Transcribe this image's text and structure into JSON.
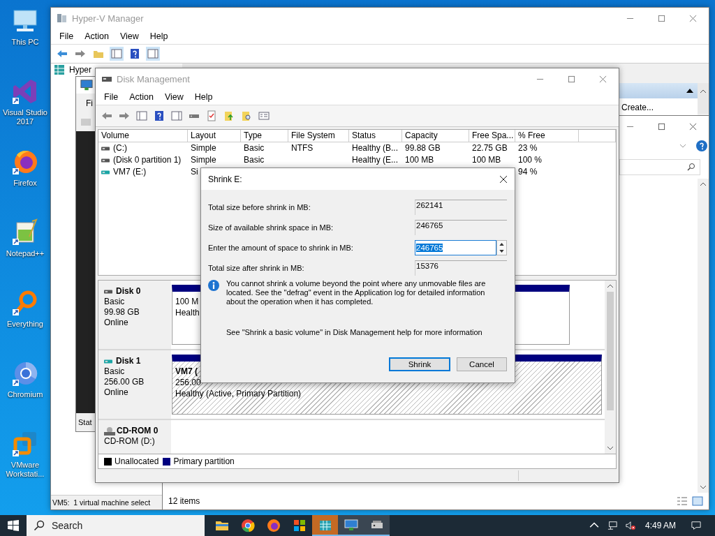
{
  "desktop_icons": [
    {
      "kind": "pc",
      "label": "This PC",
      "shortcut": false
    },
    {
      "kind": "vs",
      "label": "Visual Studio 2017",
      "shortcut": true
    },
    {
      "kind": "firefox",
      "label": "Firefox",
      "shortcut": true
    },
    {
      "kind": "notepad",
      "label": "Notepad++",
      "shortcut": true
    },
    {
      "kind": "everything",
      "label": "Everything",
      "shortcut": true
    },
    {
      "kind": "chromium",
      "label": "Chromium",
      "shortcut": true
    },
    {
      "kind": "vmware",
      "label": "VMware Workstati...",
      "shortcut": true
    }
  ],
  "hyperv": {
    "title": "Hyper-V Manager",
    "menu": [
      "File",
      "Action",
      "View",
      "Help"
    ],
    "tree_root": "Hyper",
    "actions_item": "Create...",
    "status": "VM5:  1 virtual machine select"
  },
  "vm_window": {
    "menu_item": "Fi",
    "status": "Stat"
  },
  "explorer": {
    "status": "12 items"
  },
  "disk_management": {
    "title": "Disk Management",
    "menu": [
      "File",
      "Action",
      "View",
      "Help"
    ],
    "columns": [
      "Volume",
      "Layout",
      "Type",
      "File System",
      "Status",
      "Capacity",
      "Free Spa...",
      "% Free"
    ],
    "rows": [
      {
        "kind": "hdd",
        "cells": [
          "(C:)",
          "Simple",
          "Basic",
          "NTFS",
          "Healthy (B...",
          "99.88 GB",
          "22.75 GB",
          "23 %"
        ]
      },
      {
        "kind": "hdd",
        "cells": [
          "(Disk 0 partition 1)",
          "Simple",
          "Basic",
          null,
          "Healthy (E...",
          "100 MB",
          "100 MB",
          "100 %"
        ]
      },
      {
        "kind": "vhd",
        "cells": [
          "VM7 (E:)",
          "Si",
          null,
          null,
          null,
          null,
          null,
          "94 %"
        ]
      }
    ],
    "disks": [
      {
        "kind": "hdd",
        "name": "Disk 0",
        "type": "Basic",
        "size": "99.98 GB",
        "status": "Online",
        "partitions": [
          {
            "lines": [
              "100 M",
              "Health"
            ],
            "selected": false
          },
          {
            "selected": false
          }
        ]
      },
      {
        "kind": "vhd",
        "name": "Disk 1",
        "type": "Basic",
        "size": "256.00 GB",
        "status": "Online",
        "partitions": [
          {
            "name": "VM7 (",
            "lines": [
              "256.00",
              "Healthy (Active, Primary Partition)"
            ],
            "selected": true
          }
        ]
      },
      {
        "kind": "cdrom",
        "name": "CD-ROM 0",
        "type": "CD-ROM (D:)"
      }
    ],
    "legend": [
      {
        "label": "Unallocated",
        "color": "#000000"
      },
      {
        "label": "Primary partition",
        "color": "#000080"
      }
    ]
  },
  "dialog": {
    "title": "Shrink E:",
    "fields": [
      {
        "kind": "readonly",
        "label": "Total size before shrink in MB:",
        "value": "262141"
      },
      {
        "kind": "readonly",
        "label": "Size of available shrink space in MB:",
        "value": "246765"
      },
      {
        "kind": "spin",
        "label": "Enter the amount of space to shrink in MB:",
        "value": "246765"
      },
      {
        "kind": "readonly",
        "label": "Total size after shrink in MB:",
        "value": "15376"
      }
    ],
    "info": "You cannot shrink a volume beyond the point where any unmovable files are located. See the \"defrag\" event in the Application log for detailed information about the operation when it has completed.",
    "help": "See \"Shrink a basic volume\" in Disk Management help for more information",
    "buttons": [
      {
        "label": "Shrink",
        "default": true
      },
      {
        "label": "Cancel",
        "default": false
      }
    ]
  },
  "taskbar": {
    "search": {
      "placeholder": "Search"
    },
    "apps": [
      {
        "kind": "explorer",
        "open": false,
        "attention": false
      },
      {
        "kind": "chrome",
        "open": false,
        "attention": false
      },
      {
        "kind": "firefox",
        "open": false,
        "attention": false
      },
      {
        "kind": "store",
        "open": false,
        "attention": false
      },
      {
        "kind": "hyperv",
        "open": true,
        "attention": true
      },
      {
        "kind": "vmconnect",
        "open": true,
        "attention": false
      },
      {
        "kind": "diskmgmt",
        "open": true,
        "attention": false
      }
    ],
    "tray": {
      "muted": true
    },
    "clock": "4:49 AM"
  }
}
